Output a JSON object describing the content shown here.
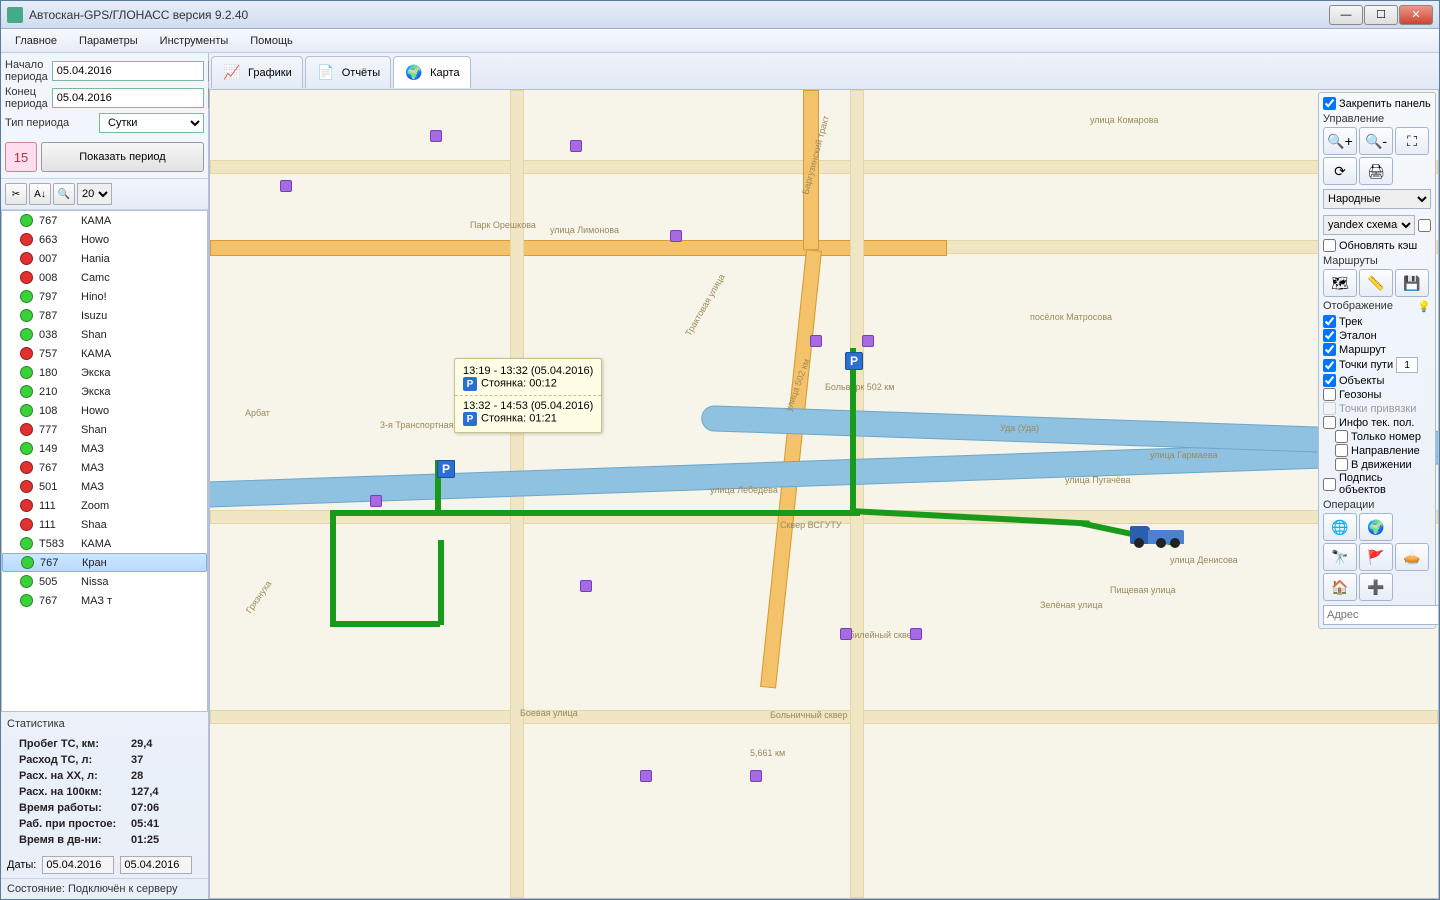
{
  "window": {
    "title": "Автоскан-GPS/ГЛОНАСС версия 9.2.40"
  },
  "menu": [
    "Главное",
    "Параметры",
    "Инструменты",
    "Помощь"
  ],
  "period": {
    "start_label": "Начало периода",
    "start_value": "05.04.2016",
    "end_label": "Конец периода",
    "end_value": "05.04.2016",
    "type_label": "Тип периода",
    "type_value": "Сутки",
    "cal_text": "15",
    "show_btn": "Показать период",
    "zoom_value": "20"
  },
  "vehicles": [
    {
      "dot": "#3bd13b",
      "num": "767",
      "name": "КАМА"
    },
    {
      "dot": "#e03030",
      "num": "663",
      "name": "Howo"
    },
    {
      "dot": "#e03030",
      "num": "007",
      "name": "Hania"
    },
    {
      "dot": "#e03030",
      "num": "008",
      "name": "Camc"
    },
    {
      "dot": "#3bd13b",
      "num": "797",
      "name": "Hino!"
    },
    {
      "dot": "#3bd13b",
      "num": "787",
      "name": "Isuzu"
    },
    {
      "dot": "#3bd13b",
      "num": "038",
      "name": "Shan"
    },
    {
      "dot": "#e03030",
      "num": "757",
      "name": "КАМА"
    },
    {
      "dot": "#3bd13b",
      "num": "180",
      "name": "Экска"
    },
    {
      "dot": "#3bd13b",
      "num": "210",
      "name": "Экска"
    },
    {
      "dot": "#3bd13b",
      "num": "108",
      "name": "Howo"
    },
    {
      "dot": "#e03030",
      "num": "777",
      "name": "Shan"
    },
    {
      "dot": "#3bd13b",
      "num": "149",
      "name": "МАЗ"
    },
    {
      "dot": "#e03030",
      "num": "767",
      "name": "МАЗ"
    },
    {
      "dot": "#e03030",
      "num": "501",
      "name": "МАЗ"
    },
    {
      "dot": "#e03030",
      "num": "111",
      "name": "Zoom"
    },
    {
      "dot": "#e03030",
      "num": "111",
      "name": "Shaa"
    },
    {
      "dot": "#3bd13b",
      "num": "Т583",
      "name": "КАМА"
    },
    {
      "dot": "#3bd13b",
      "num": "767",
      "name": "Кран",
      "selected": true
    },
    {
      "dot": "#3bd13b",
      "num": "505",
      "name": "Nissa"
    },
    {
      "dot": "#3bd13b",
      "num": "767",
      "name": "МАЗ т"
    }
  ],
  "stats": {
    "title": "Статистика",
    "rows": [
      [
        "Пробег ТС, км:",
        "29,4"
      ],
      [
        "Расход ТС, л:",
        "37"
      ],
      [
        "Расх. на ХХ, л:",
        "28"
      ],
      [
        "Расх. на 100км:",
        "127,4"
      ],
      [
        "Время работы:",
        "07:06"
      ],
      [
        "Раб. при простое:",
        "05:41"
      ],
      [
        "Время в дв-ни:",
        "01:25"
      ]
    ],
    "dates_label": "Даты:",
    "date1": "05.04.2016",
    "date2": "05.04.2016",
    "status_label": "Состояние:",
    "status_value": "Подключён к серверу"
  },
  "tabs": [
    {
      "label": "Графики",
      "icon": "📈"
    },
    {
      "label": "Отчёты",
      "icon": "📄"
    },
    {
      "label": "Карта",
      "icon": "🌍",
      "active": true
    }
  ],
  "tooltip": {
    "line1_time": "13:19 - 13:32 (05.04.2016)",
    "line1_text": "Стоянка: 00:12",
    "line2_time": "13:32 - 14:53 (05.04.2016)",
    "line2_text": "Стоянка: 01:21"
  },
  "rpanel": {
    "pin": "Закрепить панель",
    "sec_manage": "Управление",
    "sel_layer": "Народные",
    "sel_map": "yandex схема",
    "refresh_cache": "Обновлять кэш",
    "sec_routes": "Маршруты",
    "sec_display": "Отображение",
    "chk_track": "Трек",
    "chk_etalon": "Эталон",
    "chk_route": "Маршрут",
    "chk_points": "Точки пути",
    "points_num": "1",
    "chk_objects": "Объекты",
    "chk_geo": "Геозоны",
    "chk_bind": "Точки привязки",
    "chk_info": "Инфо тек. пол.",
    "chk_numonly": "Только номер",
    "chk_dir": "Направление",
    "chk_moving": "В движении",
    "chk_sign": "Подпись объектов",
    "sec_ops": "Операции",
    "addr_label": "Адрес"
  },
  "streets": {
    "s1": "улица Лимонова",
    "s2": "Трактовая улица",
    "s3": "3-я Транспортная улица",
    "s4": "улица Лебедева",
    "s5": "улица 502 км",
    "s6": "посёлок Матросова",
    "s7": "Баргузинский тракт",
    "s8": "улица Комарова",
    "s9": "Парк Орешкова",
    "s10": "улица Пугачёва",
    "s11": "улица Гармаева",
    "s12": "улица Денисова",
    "s13": "Пищевая улица",
    "s14": "Зелёная улица",
    "s15": "Юбилейный сквер",
    "s16": "Боевая улица",
    "s17": "Больничный сквер",
    "s18": "Уда (Уда)",
    "s19": "Сквер ВСГУТУ",
    "s20": "5,661 км",
    "s21": "Больверк 502 км",
    "s22": "Арбат",
    "s23": "Грязнуха"
  }
}
